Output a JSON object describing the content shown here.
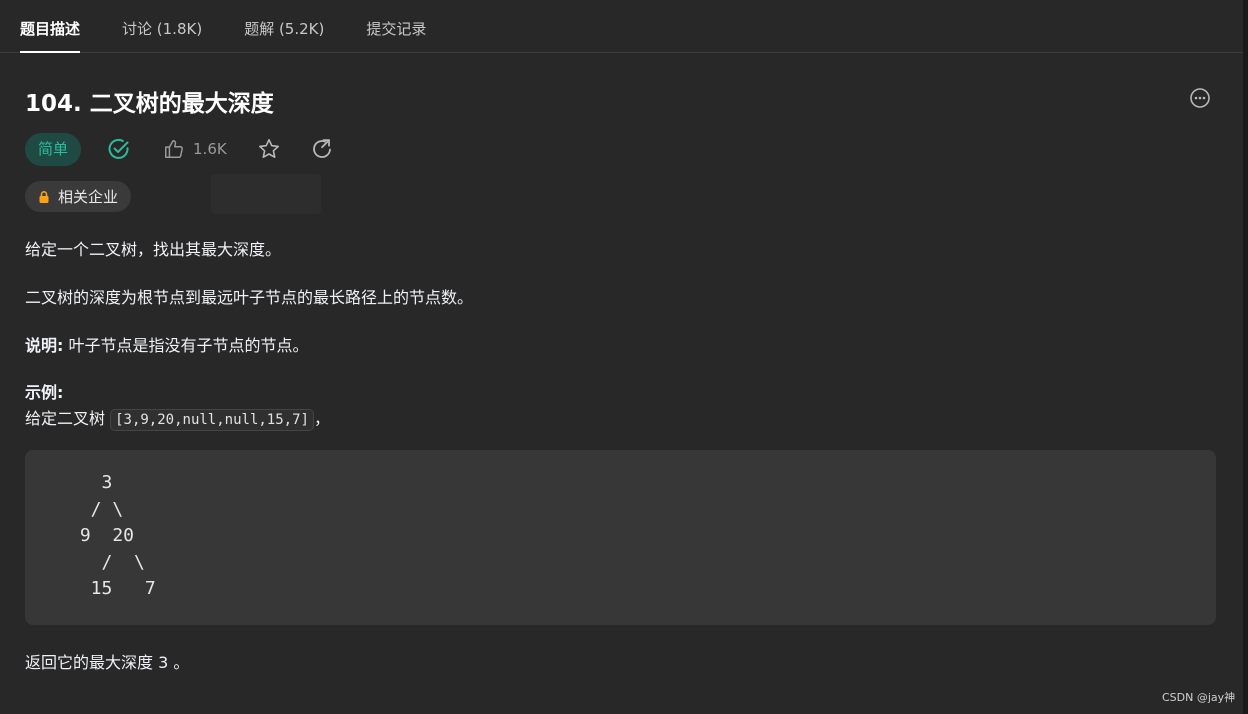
{
  "tabs": [
    {
      "label": "题目描述",
      "active": true
    },
    {
      "label": "讨论 (1.8K)",
      "active": false
    },
    {
      "label": "题解 (5.2K)",
      "active": false
    },
    {
      "label": "提交记录",
      "active": false
    }
  ],
  "problem": {
    "title": "104. 二叉树的最大深度",
    "difficulty": "简单",
    "likes": "1.6K",
    "company_tag": "相关企业"
  },
  "description": {
    "line1": "给定一个二叉树，找出其最大深度。",
    "line2": "二叉树的深度为根节点到最远叶子节点的最长路径上的节点数。",
    "note_label": "说明:",
    "note_text": " 叶子节点是指没有子节点的节点。",
    "example_label": "示例:",
    "example_prefix": "给定二叉树 ",
    "example_code": "[3,9,20,null,null,15,7]",
    "example_suffix": "，",
    "tree": "   3\n  / \\\n 9  20\n   /  \\\n  15   7",
    "result": "返回它的最大深度 3 。"
  },
  "watermark": "CSDN @jay神",
  "colors": {
    "background": "#282828",
    "difficulty_bg": "#1f4a44",
    "difficulty_text": "#2cbb9d",
    "check": "#2cbb9d",
    "lock": "#ffa116"
  },
  "icons": [
    "more-icon",
    "check-icon",
    "thumbs-up-icon",
    "star-icon",
    "share-icon",
    "lock-icon"
  ]
}
